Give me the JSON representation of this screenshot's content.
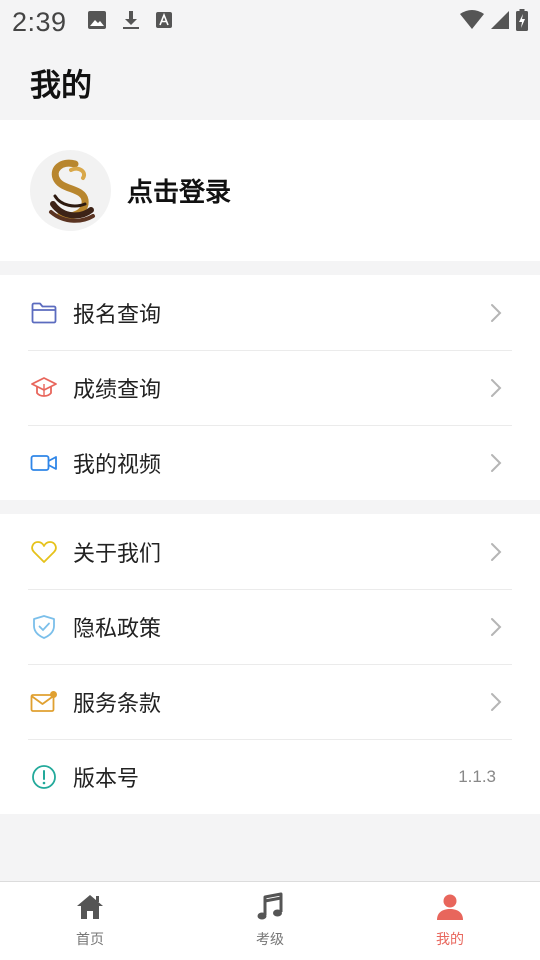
{
  "status_bar": {
    "time": "2:39",
    "left_icons": [
      "image-icon",
      "download-icon",
      "keyboard-icon"
    ],
    "right_icons": [
      "wifi-icon",
      "signal-icon",
      "battery-icon"
    ]
  },
  "header": {
    "title": "我的"
  },
  "profile": {
    "login_label": "点击登录",
    "avatar_icon": "brand-logo-icon"
  },
  "menu_group_1": [
    {
      "label": "报名查询",
      "icon": "folder-icon",
      "color": "#5b6bbf"
    },
    {
      "label": "成绩查询",
      "icon": "graduation-cap-icon",
      "color": "#e8665c"
    },
    {
      "label": "我的视频",
      "icon": "video-camera-icon",
      "color": "#2f86e8"
    }
  ],
  "menu_group_2": [
    {
      "label": "关于我们",
      "icon": "heart-icon",
      "color": "#e6c21b"
    },
    {
      "label": "隐私政策",
      "icon": "shield-check-icon",
      "color": "#7bbfea"
    },
    {
      "label": "服务条款",
      "icon": "mail-icon",
      "color": "#e0a030"
    },
    {
      "label": "版本号",
      "icon": "info-circle-icon",
      "color": "#22a99a",
      "value": "1.1.3"
    }
  ],
  "tab_bar": {
    "tabs": [
      {
        "label": "首页",
        "icon": "home-icon"
      },
      {
        "label": "考级",
        "icon": "music-note-icon"
      },
      {
        "label": "我的",
        "icon": "person-icon",
        "active": true
      }
    ],
    "active_color": "#e8665c",
    "inactive_color": "#555555"
  }
}
